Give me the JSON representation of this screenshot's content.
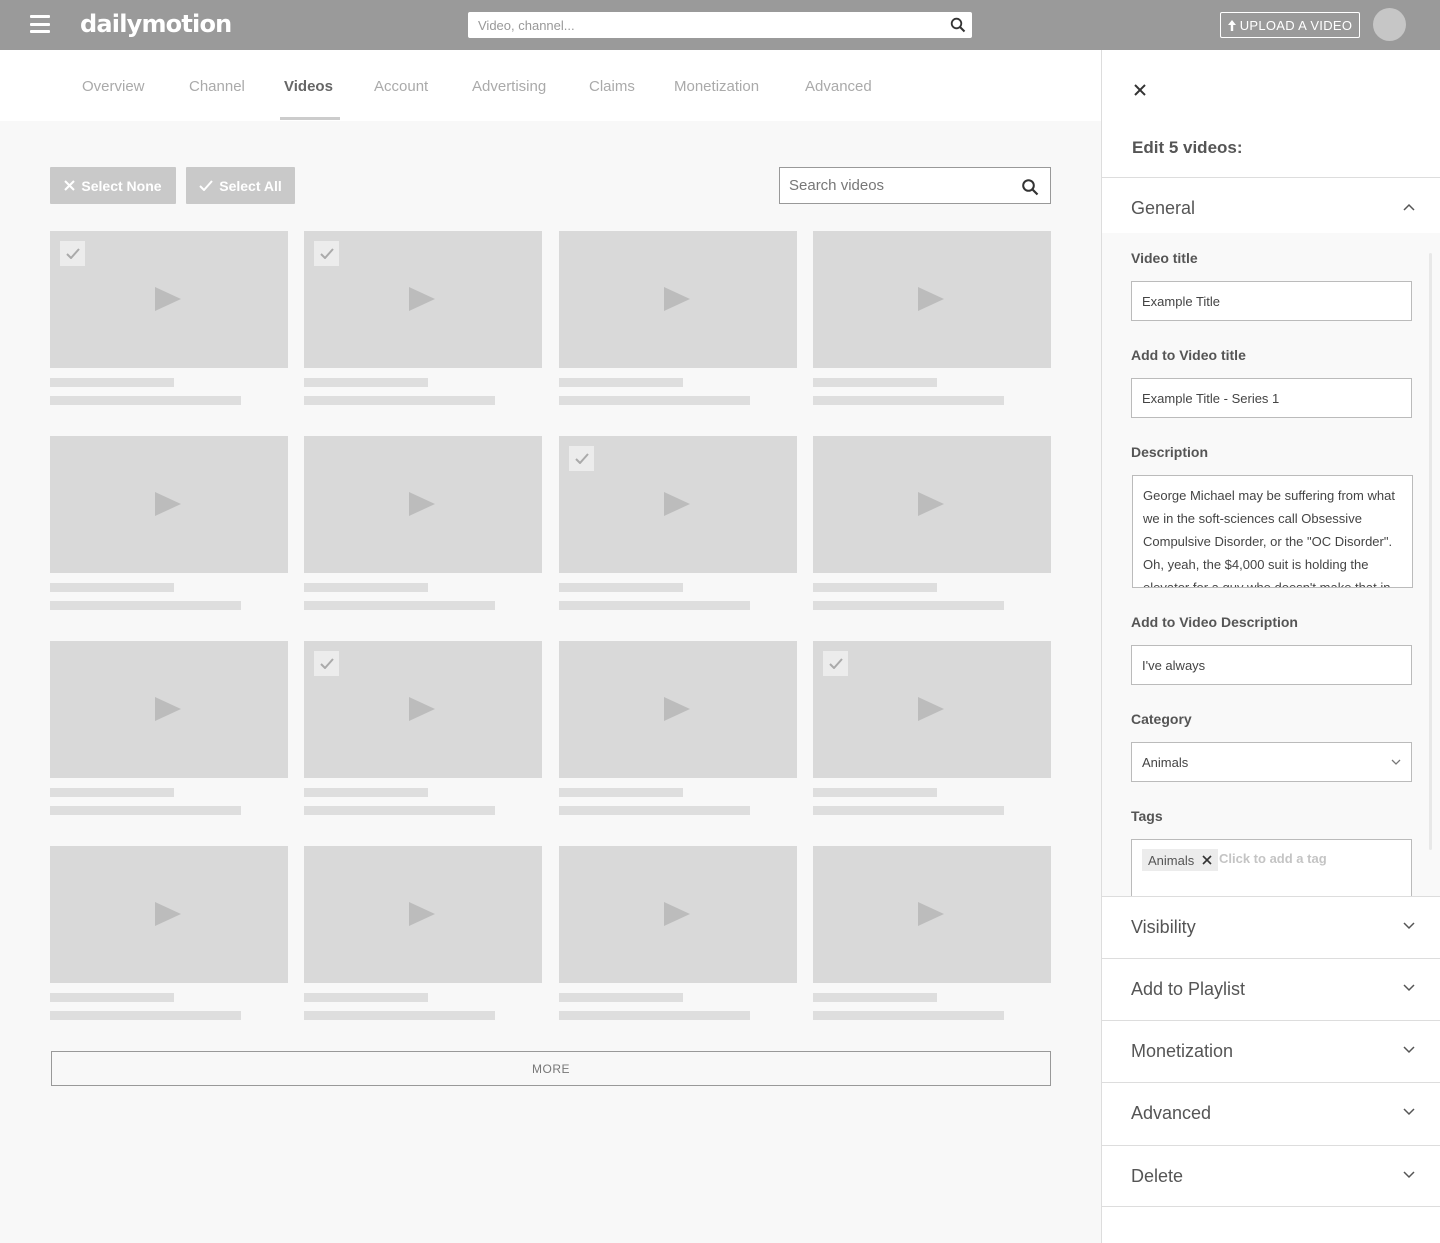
{
  "header": {
    "logo": "dailymotion",
    "search_placeholder": "Video, channel...",
    "upload_label": "UPLOAD A VIDEO"
  },
  "tabs": [
    "Overview",
    "Channel",
    "Videos",
    "Account",
    "Advertising",
    "Claims",
    "Monetization",
    "Advanced"
  ],
  "active_tab": "Videos",
  "toolbar": {
    "select_none": "Select None",
    "select_all": "Select All",
    "search_placeholder": "Search videos"
  },
  "videos": {
    "count": 16,
    "selected": [
      true,
      true,
      false,
      false,
      false,
      false,
      true,
      false,
      false,
      true,
      false,
      true,
      false,
      false,
      false,
      false
    ]
  },
  "more_label": "MORE",
  "panel": {
    "title": "Edit 5 videos:",
    "general": {
      "label": "General",
      "video_title_label": "Video title",
      "video_title_value": "Example Title",
      "add_title_label": "Add to Video title",
      "add_title_value": "Example Title - Series 1",
      "description_label": "Description",
      "description_value": "George Michael may be suffering from what we in the soft-sciences call Obsessive Compulsive Disorder, or the \"OC Disorder\". Oh, yeah, the $4,000 suit is holding the elevator for a guy who doesn't make that in",
      "add_description_label": "Add to Video Description",
      "add_description_value": "I've always",
      "category_label": "Category",
      "category_value": "Animals",
      "tags_label": "Tags",
      "tags": [
        "Animals"
      ],
      "tags_placeholder": "Click to add a tag"
    },
    "sections": [
      "Visibility",
      "Add to Playlist",
      "Monetization",
      "Advanced",
      "Delete"
    ]
  },
  "colors": {
    "header_bg": "#9a9a9a",
    "thumb_bg": "#d9d9d9",
    "button_bg": "#c9c9c9"
  }
}
